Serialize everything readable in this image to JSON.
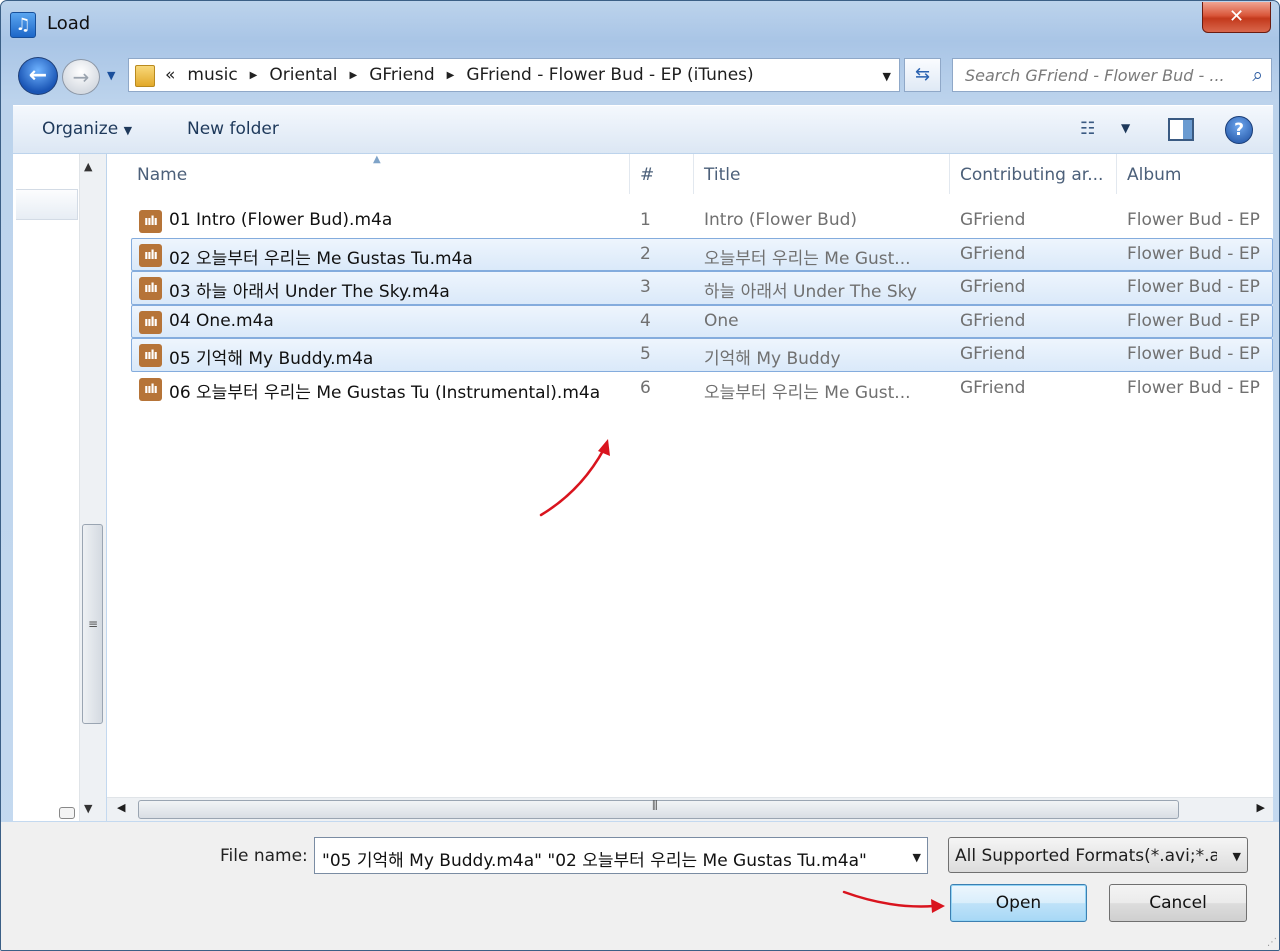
{
  "window": {
    "title": "Load",
    "close_label": "✕"
  },
  "address": {
    "overflow": "«",
    "crumbs": [
      "music",
      "Oriental",
      "GFriend",
      "GFriend - Flower Bud - EP (iTunes)"
    ]
  },
  "search": {
    "placeholder": "Search GFriend - Flower Bud - ..."
  },
  "toolbar": {
    "organize_label": "Organize",
    "new_folder_label": "New folder"
  },
  "columns": {
    "name": "Name",
    "num": "#",
    "title": "Title",
    "artist": "Contributing ar...",
    "album": "Album"
  },
  "files": [
    {
      "name": "01 Intro (Flower Bud).m4a",
      "num": "1",
      "title": "Intro (Flower Bud)",
      "artist": "GFriend",
      "album": "Flower Bud - EP",
      "selected": false
    },
    {
      "name": "02 오늘부터 우리는 Me Gustas Tu.m4a",
      "num": "2",
      "title": "오늘부터 우리는 Me Gust...",
      "artist": "GFriend",
      "album": "Flower Bud - EP",
      "selected": true
    },
    {
      "name": "03 하늘 아래서 Under The Sky.m4a",
      "num": "3",
      "title": "하늘 아래서 Under The Sky",
      "artist": "GFriend",
      "album": "Flower Bud - EP",
      "selected": true
    },
    {
      "name": "04 One.m4a",
      "num": "4",
      "title": "One",
      "artist": "GFriend",
      "album": "Flower Bud - EP",
      "selected": true
    },
    {
      "name": "05 기억해 My Buddy.m4a",
      "num": "5",
      "title": "기억해 My Buddy",
      "artist": "GFriend",
      "album": "Flower Bud - EP",
      "selected": true
    },
    {
      "name": "06 오늘부터 우리는 Me Gustas Tu (Instrumental).m4a",
      "num": "6",
      "title": "오늘부터 우리는 Me Gust...",
      "artist": "GFriend",
      "album": "Flower Bud - EP",
      "selected": false
    }
  ],
  "footer": {
    "file_name_label": "File name:",
    "file_name_value": "\"05 기억해 My Buddy.m4a\" \"02 오늘부터 우리는 Me Gustas Tu.m4a\"",
    "filter_value": "All Supported Formats(*.avi;*.asf",
    "open_label": "Open",
    "cancel_label": "Cancel"
  },
  "colors": {
    "selection_fill": "#dae9f9",
    "selection_border": "#84acdd",
    "annotation_arrow": "#d9141e",
    "file_icon": "#b67438"
  },
  "icons": [
    "music-app-icon",
    "back-arrow-icon",
    "forward-arrow-icon",
    "folder-icon",
    "refresh-icon",
    "search-icon",
    "views-icon",
    "preview-pane-icon",
    "help-icon",
    "audio-file-icon"
  ]
}
